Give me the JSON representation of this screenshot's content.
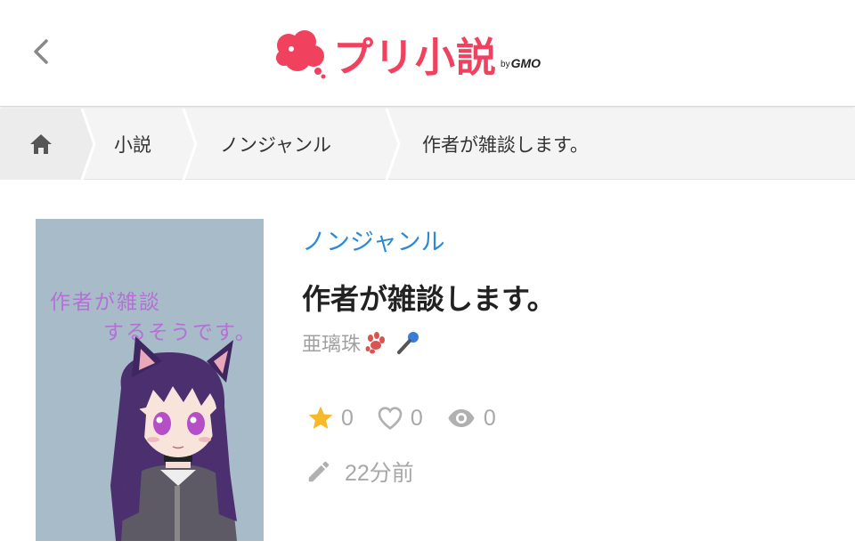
{
  "header": {
    "logo_text": "プリ小説",
    "logo_by": "by",
    "logo_gmo": "GMO",
    "brand_color": "#f0415f"
  },
  "breadcrumb": {
    "items": [
      "小説",
      "ノンジャンル",
      "作者が雑談します。"
    ]
  },
  "story": {
    "cover_text_line1": "作者が雑談",
    "cover_text_line2": "するそうです。",
    "genre": "ノンジャンル",
    "title": "作者が雑談します。",
    "author": "亜璃珠",
    "author_icons": [
      "paw-icon",
      "microphone-icon"
    ],
    "stars": "0",
    "likes": "0",
    "views": "0",
    "updated": "22分前",
    "genre_color": "#2b8ad6"
  }
}
